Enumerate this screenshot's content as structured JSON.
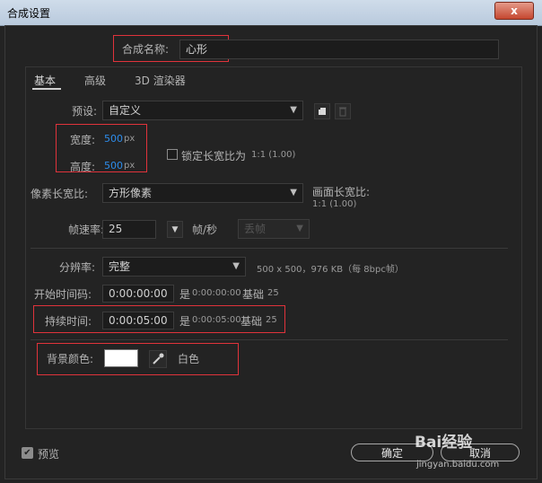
{
  "window": {
    "title": "合成设置",
    "close": "x"
  },
  "comp_name": {
    "label": "合成名称:",
    "value": "心形"
  },
  "tabs": [
    "基本",
    "高级",
    "3D 渲染器"
  ],
  "preset": {
    "label": "预设:",
    "value": "自定义"
  },
  "width": {
    "label": "宽度:",
    "value": "500",
    "unit": "px"
  },
  "height": {
    "label": "高度:",
    "value": "500",
    "unit": "px"
  },
  "lock_aspect": {
    "label": "锁定长宽比为",
    "value": "1:1 (1.00)",
    "checked": false
  },
  "pixel_aspect": {
    "label": "像素长宽比:",
    "value": "方形像素"
  },
  "frame_aspect": {
    "label": "画面长宽比:",
    "value": "1:1 (1.00)"
  },
  "frame_rate": {
    "label": "帧速率:",
    "value": "25",
    "unit": "帧/秒",
    "drop": "丢帧"
  },
  "resolution": {
    "label": "分辨率:",
    "value": "完整",
    "info": "500 x 500，976 KB（每 8bpc帧）"
  },
  "start_timecode": {
    "label": "开始时间码:",
    "value": "0:00:00:00",
    "is_prefix": "是",
    "is_value": "0:00:00:00",
    "base_label": "基础",
    "base_value": "25"
  },
  "duration": {
    "label": "持续时间:",
    "value": "0:00:05:00",
    "is_prefix": "是",
    "is_value": "0:00:05:00",
    "base_label": "基础",
    "base_value": "25"
  },
  "background": {
    "label": "背景颜色:",
    "name": "白色",
    "color": "#ffffff"
  },
  "preview": {
    "label": "预览",
    "checked": true
  },
  "buttons": {
    "ok": "确定",
    "cancel": "取消"
  },
  "watermark": {
    "brand": "Bai经验",
    "url": "jingyan.baidu.com"
  }
}
